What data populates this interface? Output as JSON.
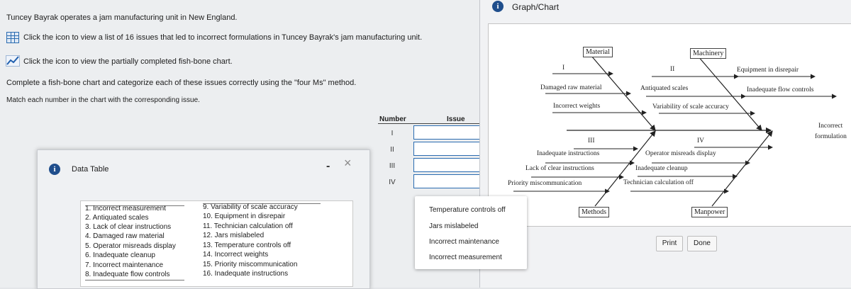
{
  "instructions": {
    "line1": "Tuncey Bayrak operates a jam manufacturing unit in New England.",
    "line2": "Click the icon to view a list of 16 issues that led to incorrect formulations in Tuncey Bayrak's jam manufacturing unit.",
    "line3": "Click the icon to view the partially completed fish-bone chart.",
    "line4": "Complete a fish-bone chart and categorize each of these issues correctly using the \"four Ms\" method.",
    "line5": "Match each number in the chart with the corresponding issue."
  },
  "answer_table": {
    "header_number": "Number",
    "header_issue": "Issue",
    "rows": [
      "I",
      "II",
      "III",
      "IV"
    ]
  },
  "data_table": {
    "title": "Data Table",
    "minimize": "-",
    "close": "X",
    "issues_col1": [
      "1. Incorrect measurement",
      "2. Antiquated scales",
      "3. Lack of clear instructions",
      "4. Damaged raw material",
      "5. Operator misreads display",
      "6. Inadequate cleanup",
      "7. Incorrect maintenance",
      "8. Inadequate flow controls"
    ],
    "issues_col2": [
      "9. Variability of scale accuracy",
      "10. Equipment in disrepair",
      "11. Technician calculation off",
      "12. Jars mislabeled",
      "13. Temperature controls off",
      "14. Incorrect weights",
      "15. Priority miscommunication",
      "16. Inadequate instructions"
    ]
  },
  "dropdown": {
    "options": [
      "Temperature controls off",
      "Jars mislabeled",
      "Incorrect maintenance",
      "Incorrect measurement"
    ]
  },
  "chart_panel": {
    "title": "Graph/Chart",
    "print": "Print",
    "done": "Done",
    "categories": {
      "material": "Material",
      "machinery": "Machinery",
      "methods": "Methods",
      "manpower": "Manpower"
    },
    "roman": {
      "i": "I",
      "ii": "II",
      "iii": "III",
      "iv": "IV"
    },
    "effect_line1": "Incorrect",
    "effect_line2": "formulation",
    "labels": {
      "damaged": "Damaged raw material",
      "incorrect_weights": "Incorrect weights",
      "antiquated": "Antiquated scales",
      "variability": "Variability of scale accuracy",
      "equipment": "Equipment in disrepair",
      "flow": "Inadequate flow controls",
      "inadequate_instr": "Inadequate instructions",
      "lack_instr": "Lack of clear instructions",
      "priority": "Priority miscommunication",
      "operator": "Operator misreads display",
      "cleanup": "Inadequate cleanup",
      "technician": "Technician calculation off"
    }
  }
}
